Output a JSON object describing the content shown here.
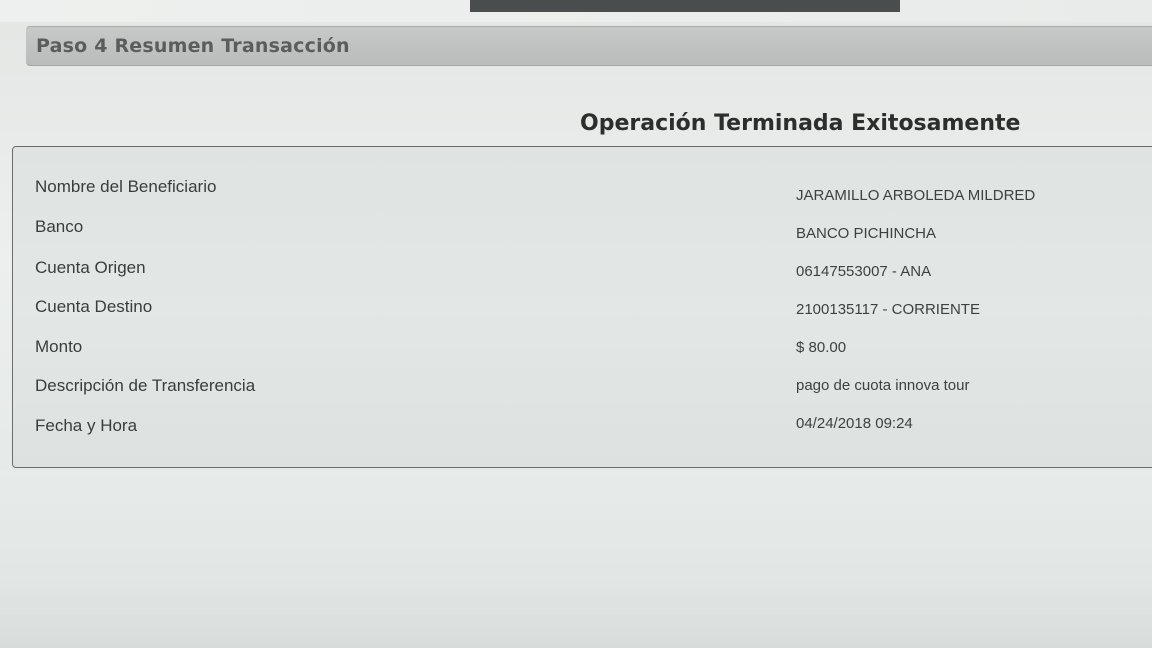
{
  "step": {
    "title": "Paso 4 Resumen Transacción"
  },
  "result": {
    "heading": "Operación Terminada Exitosamente"
  },
  "details": [
    {
      "label": "Nombre del Beneficiario",
      "value": "JARAMILLO ARBOLEDA MILDRED"
    },
    {
      "label": "Banco",
      "value": "BANCO PICHINCHA"
    },
    {
      "label": "Cuenta Origen",
      "value": "06147553007 - ANA"
    },
    {
      "label": "Cuenta Destino",
      "value": "2100135117 - CORRIENTE"
    },
    {
      "label": "Monto",
      "value": "$ 80.00"
    },
    {
      "label": "Descripción de Transferencia",
      "value": "pago de cuota innova tour"
    },
    {
      "label": "Fecha y Hora",
      "value": "04/24/2018 09:24"
    }
  ]
}
